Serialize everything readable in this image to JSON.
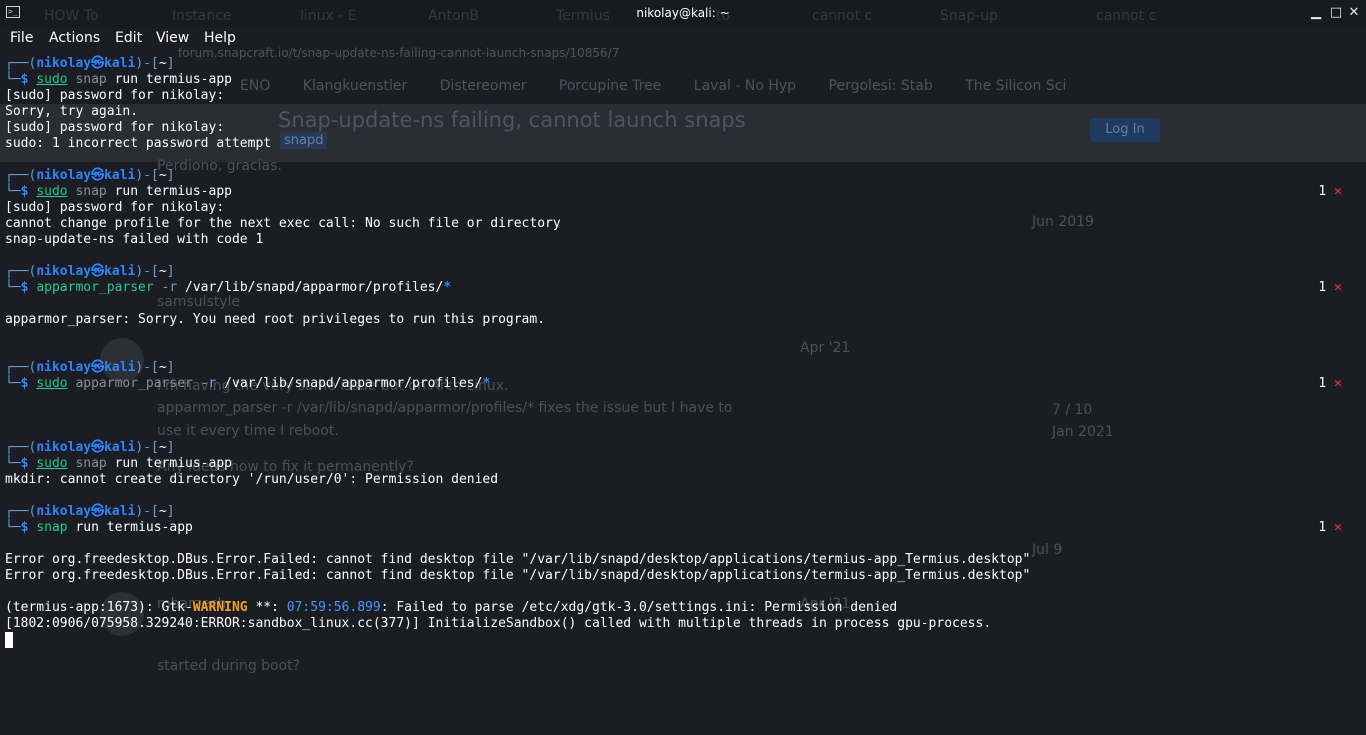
{
  "window": {
    "title": "nikolay@kali: ~",
    "minimize_icon": "minimize-icon",
    "maximize_icon": "maximize-icon",
    "close_icon": "close-icon"
  },
  "menu": [
    "File",
    "Actions",
    "Edit",
    "View",
    "Help"
  ],
  "background_browser": {
    "tabs": [
      "HOW To",
      "Instance",
      "linux - E",
      "AntonB",
      "Termius",
      "to",
      "cannot c",
      "Snap-up",
      "cannot c"
    ],
    "address": "forum.snapcraft.io/t/snap-update-ns-failing-cannot-launch-snaps/10856/7",
    "bookmarks": [
      "ENO",
      "Klangkuenstler",
      "Distereomer",
      "Porcupine Tree",
      "Laval - No Hyp",
      "Pergolesi: Stab",
      "The Silicon Sci"
    ],
    "login_button": "Log In",
    "topic_title": "Snap-update-ns failing, cannot launch snaps",
    "topic_tag": "snapd",
    "fragments": [
      "Perdiono, gracias.",
      "Jun 2019",
      "samsulstyle",
      "Apr '21",
      "I'm having the very same issue but on Arch Linux.",
      "apparmor_parser -r /var/lib/snapd/apparmor/profiles/* fixes the issue but I have to",
      "use it every time I reboot.",
      "7 / 10",
      "Jan 2021",
      "Any ideas how to fix it permanently?",
      "Jul 9",
      "mbarzech",
      "Apr '21",
      "started during boot?"
    ]
  },
  "terminal": {
    "user": "nikolay",
    "host": "kali",
    "dir": "~",
    "blocks": [
      {
        "sudo": true,
        "cmd": "snap",
        "args": " run termius-app",
        "status": "",
        "output": [
          "[sudo] password for nikolay:",
          "Sorry, try again.",
          "[sudo] password for nikolay:",
          "sudo: 1 incorrect password attempt"
        ]
      },
      {
        "sudo": true,
        "cmd": "snap",
        "args": " run termius-app",
        "status": "1",
        "output": [
          "[sudo] password for nikolay:",
          "cannot change profile for the next exec call: No such file or directory",
          "snap-update-ns failed with code 1"
        ]
      },
      {
        "sudo": false,
        "cmd": "apparmor_parser",
        "flag": "-r",
        "path": " /var/lib/snapd/apparmor/profiles/",
        "glob": "*",
        "status": "1",
        "output": [
          "",
          "apparmor_parser: Sorry. You need root privileges to run this program."
        ]
      },
      {
        "sudo": true,
        "cmd": "apparmor_parser",
        "flag": "-r",
        "path": " /var/lib/snapd/apparmor/profiles/",
        "glob": "*",
        "status": "1",
        "output": []
      },
      {
        "sudo": true,
        "cmd": "snap",
        "args": " run termius-app",
        "status": "",
        "output": [
          "mkdir: cannot create directory '/run/user/0': Permission denied"
        ]
      },
      {
        "sudo": false,
        "cmd": "snap",
        "args": " run termius-app",
        "status": "1",
        "output": [
          "",
          "Error org.freedesktop.DBus.Error.Failed: cannot find desktop file \"/var/lib/snapd/desktop/applications/termius-app_Termius.desktop\"",
          "Error org.freedesktop.DBus.Error.Failed: cannot find desktop file \"/var/lib/snapd/desktop/applications/termius-app_Termius.desktop\"",
          ""
        ]
      }
    ],
    "gtk_line": {
      "prefix": "(termius-app:1673): Gtk-",
      "level": "WARNING",
      "mid": " **: ",
      "time": "07:59:56.899",
      "rest": ": Failed to parse /etc/xdg/gtk-3.0/settings.ini: Permission denied"
    },
    "last_line": "[1802:0906/075958.329240:ERROR:sandbox_linux.cc(377)] InitializeSandbox() called with multiple threads in process gpu-process.",
    "error_mark": "✕"
  }
}
